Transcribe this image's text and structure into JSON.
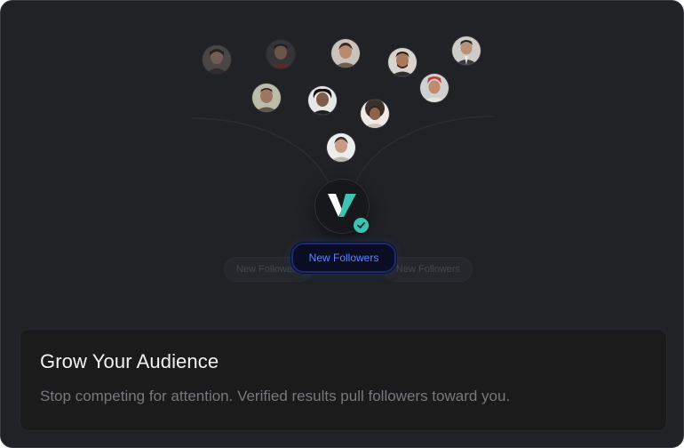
{
  "card": {
    "title": "Grow Your Audience",
    "description": "Stop competing for attention. Verified results pull followers toward you."
  },
  "hero": {
    "active_badge": "New Followers",
    "ghost_badges": [
      "New Followers",
      "New Followers"
    ],
    "brand_logo": "v-logo-icon",
    "verified_icon": "check-badge-icon",
    "avatar_count": 10
  },
  "colors": {
    "background": "#212226",
    "panel": "#1b1b1c",
    "accent_blue": "#5d86ff",
    "brand_teal": "#3cc3b2"
  }
}
